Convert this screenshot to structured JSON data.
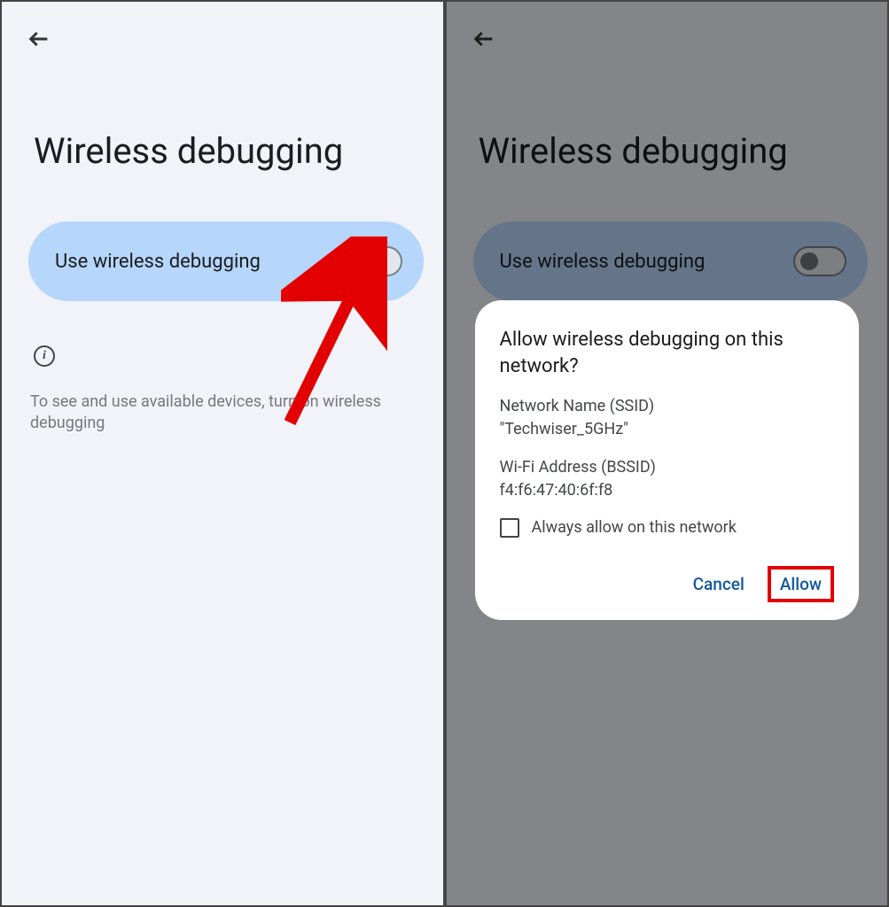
{
  "left": {
    "title": "Wireless debugging",
    "toggle_label": "Use wireless debugging",
    "info_text": "To see and use available devices, turn on wireless debugging"
  },
  "right": {
    "title": "Wireless debugging",
    "toggle_label": "Use wireless debugging",
    "dialog": {
      "title": "Allow wireless debugging on this network?",
      "ssid_label": "Network Name (SSID)",
      "ssid_value": "\"Techwiser_5GHz\"",
      "bssid_label": "Wi-Fi Address (BSSID)",
      "bssid_value": "f4:f6:47:40:6f:f8",
      "checkbox_label": "Always allow on this network",
      "cancel": "Cancel",
      "allow": "Allow"
    }
  }
}
